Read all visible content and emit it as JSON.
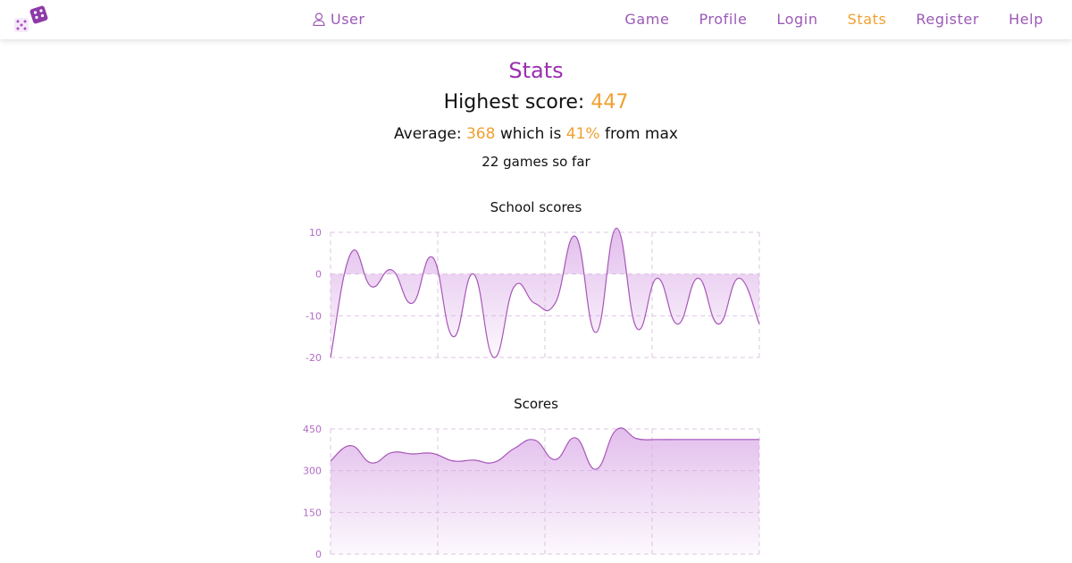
{
  "nav": {
    "user_label": "User",
    "links": [
      {
        "label": "Game"
      },
      {
        "label": "Profile"
      },
      {
        "label": "Login"
      },
      {
        "label": "Stats",
        "active": true
      },
      {
        "label": "Register"
      },
      {
        "label": "Help"
      }
    ]
  },
  "stats": {
    "title": "Stats",
    "highest_label": "Highest score:",
    "highest_value": "447",
    "average_label": "Average:",
    "average_value": "368",
    "average_mid": "which is",
    "average_percent": "41%",
    "average_suffix": "from max",
    "games_text": "22 games so far"
  },
  "colors": {
    "accent": "#f0a030",
    "brand": "#9b59b6",
    "line": "#a855b8",
    "fill": "#d9a8e6"
  },
  "chart_data": [
    {
      "type": "area",
      "title": "School scores",
      "x": [
        1,
        2,
        3,
        4,
        5,
        6,
        7,
        8,
        9,
        10,
        11,
        12,
        13,
        14,
        15,
        16,
        17,
        18,
        19,
        20,
        21,
        22
      ],
      "values": [
        -20,
        5,
        -3,
        1,
        -7,
        4,
        -15,
        0,
        -20,
        -3,
        -7,
        -7,
        9,
        -14,
        11,
        -13,
        -1,
        -12,
        -1,
        -12,
        -1,
        -12
      ],
      "ylim": [
        -20,
        10
      ],
      "yticks": [
        "10",
        "0",
        "-10",
        "-20"
      ],
      "grid": true
    },
    {
      "type": "area",
      "title": "Scores",
      "x": [
        1,
        2,
        3,
        4,
        5,
        6,
        7,
        8,
        9,
        10,
        11,
        12,
        13,
        14,
        15,
        16,
        17,
        18,
        19,
        20,
        21,
        22
      ],
      "values": [
        335,
        390,
        328,
        365,
        360,
        362,
        335,
        338,
        330,
        380,
        410,
        340,
        418,
        305,
        447,
        415,
        412,
        412,
        412,
        412,
        412,
        412
      ],
      "ylim": [
        0,
        450
      ],
      "yticks": [
        "450",
        "300",
        "150",
        "0"
      ],
      "grid": true
    }
  ]
}
